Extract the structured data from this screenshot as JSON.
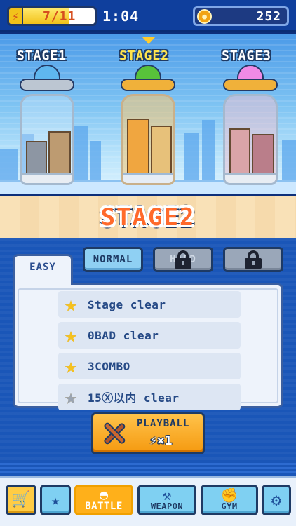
{
  "status": {
    "energy_current": "7",
    "energy_max": "11",
    "energy_text": "7/11",
    "energy_fraction": 0.636,
    "timer": "1:04",
    "coins": "252"
  },
  "stages": [
    {
      "label": "STAGE1",
      "active": false
    },
    {
      "label": "STAGE2",
      "active": true
    },
    {
      "label": "STAGE3",
      "active": false
    }
  ],
  "stage_title": "STAGE2",
  "difficulty_tabs": {
    "easy": "EASY",
    "normal": "NORMAL",
    "hard": "HARD",
    "locked_extra": ""
  },
  "missions": [
    {
      "text": "Stage clear",
      "achieved": true
    },
    {
      "text": "0BAD clear",
      "achieved": true
    },
    {
      "text": "3COMBO",
      "achieved": true
    },
    {
      "text": "15Ⓧ以内 clear",
      "achieved": false
    }
  ],
  "play_button": {
    "label": "PLAYBALL",
    "cost": "×1"
  },
  "nav": {
    "battle": "BATTLE",
    "weapon": "WEAPON",
    "gym": "GYM"
  },
  "colors": {
    "ufo1": "#5fb7f0",
    "ufo2": "#58c23a",
    "ufo3": "#f08ae6",
    "accent_orange": "#f59a10",
    "title_orange": "#ff6a2b",
    "star_gold": "#f6c21e"
  }
}
